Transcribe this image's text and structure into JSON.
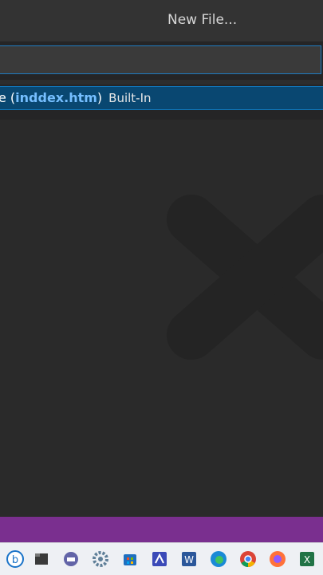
{
  "titlebar": {
    "label": "New File..."
  },
  "quick_input": {
    "value": "",
    "item": {
      "prefix": "e (",
      "highlight": "inddex.htm",
      "suffix": ")",
      "description": "Built-In"
    }
  },
  "colors": {
    "accent": "#1177bb",
    "selection": "#094771",
    "statusbar": "#7a2f8f",
    "highlight_text": "#75beff"
  },
  "taskbar": {
    "icons": [
      "search-icon",
      "file-explorer-icon",
      "teams-chat-icon",
      "settings-icon",
      "microsoft-store-icon",
      "visual-studio-icon",
      "word-icon",
      "edge-icon",
      "chrome-icon",
      "firefox-icon",
      "excel-icon"
    ]
  }
}
